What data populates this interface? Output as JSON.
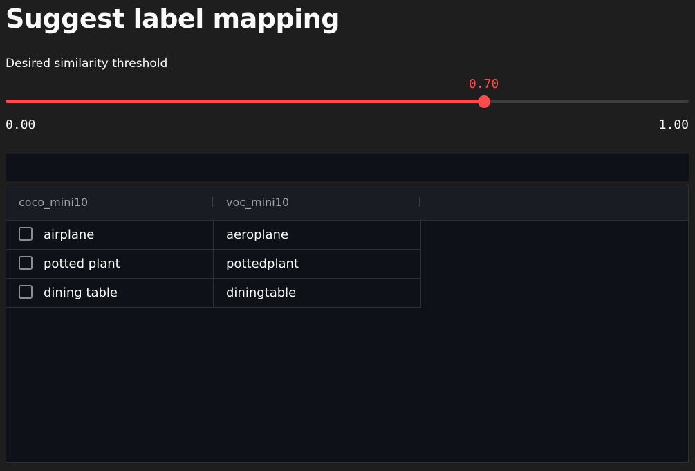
{
  "page": {
    "title": "Suggest label mapping"
  },
  "slider": {
    "label": "Desired similarity threshold",
    "value": 0.7,
    "value_text": "0.70",
    "min": 0,
    "max": 1,
    "min_text": "0.00",
    "max_text": "1.00",
    "accent_color": "#ff4b4b"
  },
  "table": {
    "columns": [
      "coco_mini10",
      "voc_mini10"
    ],
    "rows": [
      {
        "checked": false,
        "coco": "airplane",
        "voc": "aeroplane"
      },
      {
        "checked": false,
        "coco": "potted plant",
        "voc": "pottedplant"
      },
      {
        "checked": false,
        "coco": "dining table",
        "voc": "diningtable"
      }
    ]
  }
}
